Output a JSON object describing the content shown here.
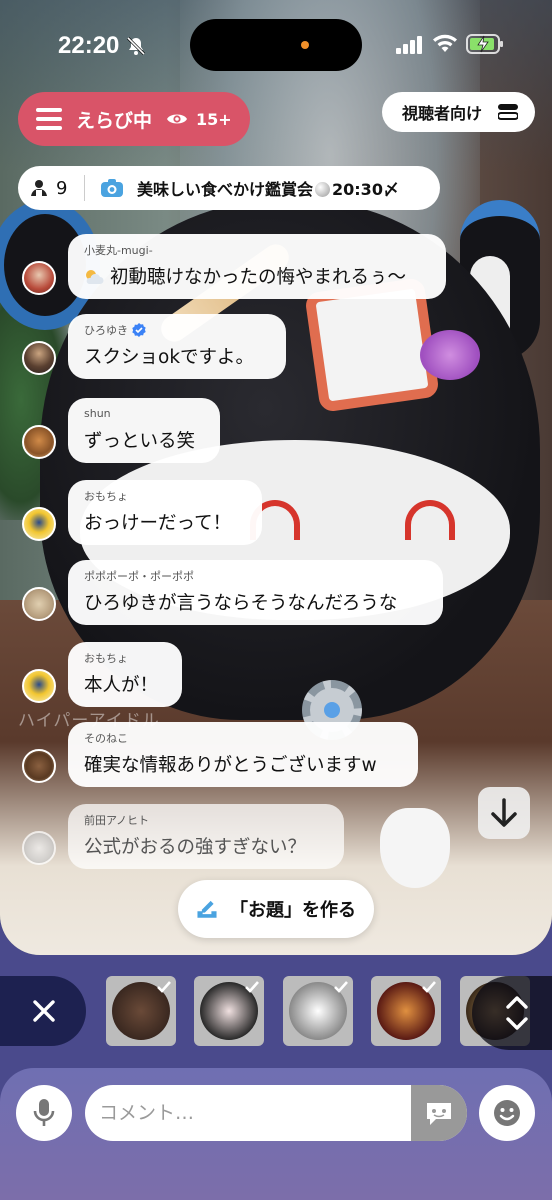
{
  "status_bar": {
    "time": "22:20"
  },
  "header": {
    "choosing_label": "えらび中",
    "viewer_age": "15+",
    "audience_label": "視聴者向け"
  },
  "topic": {
    "participant_count": "9",
    "title": "美味しい食べかけ鑑賞会",
    "time_suffix": "20:30〆"
  },
  "comments": [
    {
      "name": "小麦丸-mugi-",
      "text": "初動聴けなかったの悔やまれるぅ〜",
      "icon": "cloud-sun-icon"
    },
    {
      "name": "ひろゆき",
      "text": "スクショokですよ。",
      "verified": true
    },
    {
      "name": "shun",
      "text": "ずっといる笑"
    },
    {
      "name": "おもちょ",
      "text": "おっけーだって！"
    },
    {
      "name": "ポポポーポ・ポーポポ",
      "text": "ひろゆきが言うならそうなんだろうな"
    },
    {
      "name": "おもちょ",
      "text": "本人が！"
    },
    {
      "name": "そのねこ",
      "text": "確実な情報ありがとうございますw"
    },
    {
      "name": "前田アノヒト",
      "text": "公式がおるの強すぎない？"
    }
  ],
  "scene": {
    "watermark": "ハイパーアイドル"
  },
  "make_topic_label": "「お題」を作る",
  "input": {
    "placeholder": "コメント…"
  },
  "colors": {
    "choosing_pill": "#d95468",
    "bottom_bar": "#6f6fb2",
    "strip_close": "#1d2150",
    "accent_blue": "#4aa3e0"
  }
}
